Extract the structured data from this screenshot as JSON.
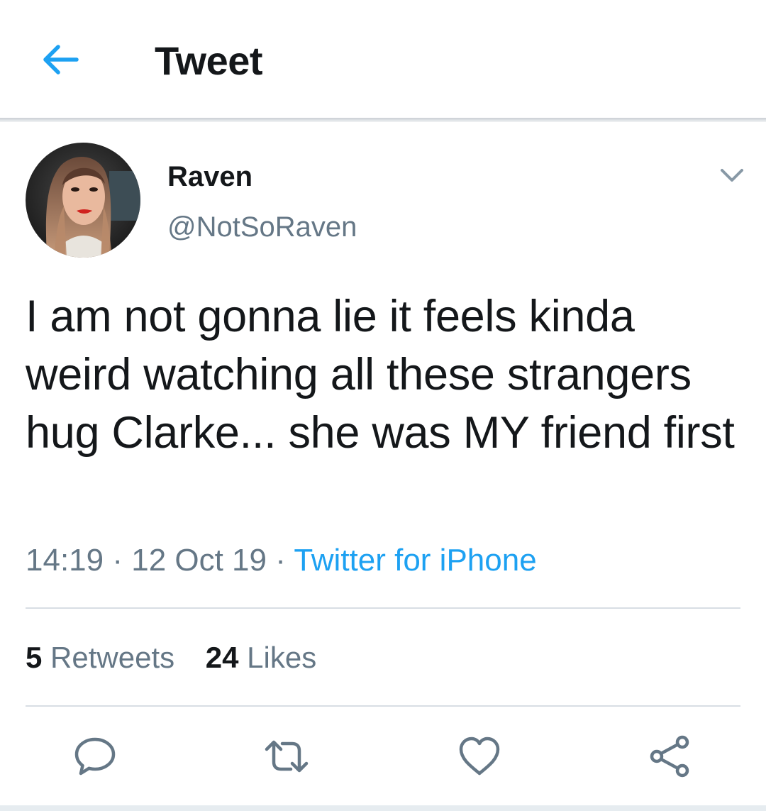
{
  "header": {
    "title": "Tweet",
    "back_icon": "arrow-left-icon",
    "accent_color": "#1da1f2"
  },
  "tweet": {
    "author": {
      "display_name": "Raven",
      "handle": "@NotSoRaven",
      "avatar_icon": "profile-photo"
    },
    "menu_icon": "chevron-down-icon",
    "text": "I am not gonna lie it feels kinda weird watching all these strangers hug Clarke... she was MY friend first",
    "time": "14:19",
    "separator": " · ",
    "date": "12 Oct 19",
    "source": "Twitter for iPhone",
    "stats": {
      "retweets_count": "5",
      "retweets_label": "Retweets",
      "likes_count": "24",
      "likes_label": "Likes"
    },
    "actions": [
      {
        "icon": "reply-icon"
      },
      {
        "icon": "retweet-icon"
      },
      {
        "icon": "like-heart-icon"
      },
      {
        "icon": "share-icon"
      }
    ]
  },
  "colors": {
    "text_primary": "#14171a",
    "text_secondary": "#657786",
    "link": "#1da1f2",
    "divider": "#d8dee4"
  }
}
